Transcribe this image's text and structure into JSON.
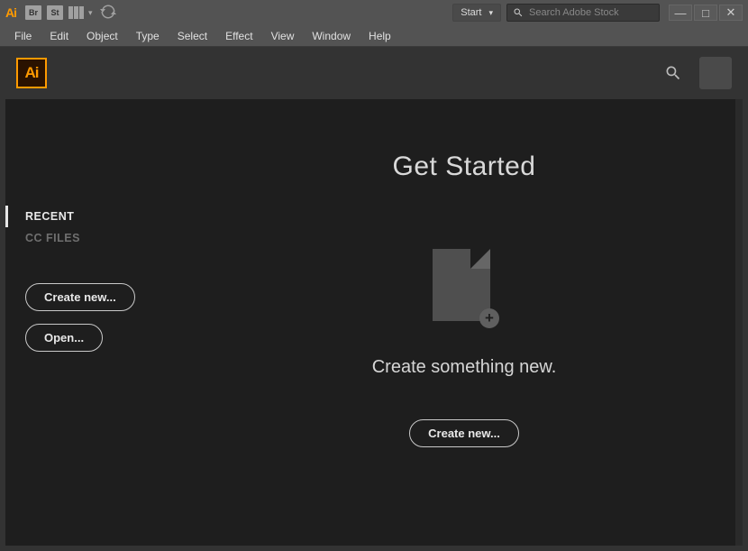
{
  "titlebar": {
    "app_abbrev": "Ai",
    "mini_badges": [
      "Br",
      "St"
    ],
    "start_label": "Start",
    "search_placeholder": "Search Adobe Stock"
  },
  "menubar": {
    "items": [
      "File",
      "Edit",
      "Object",
      "Type",
      "Select",
      "Effect",
      "View",
      "Window",
      "Help"
    ]
  },
  "workspace": {
    "app_box_label": "Ai"
  },
  "sidebar": {
    "tabs": [
      {
        "label": "RECENT",
        "active": true
      },
      {
        "label": "CC FILES",
        "active": false
      }
    ],
    "create_label": "Create new...",
    "open_label": "Open..."
  },
  "main": {
    "heading": "Get Started",
    "subtitle": "Create something new.",
    "create_label": "Create new..."
  }
}
